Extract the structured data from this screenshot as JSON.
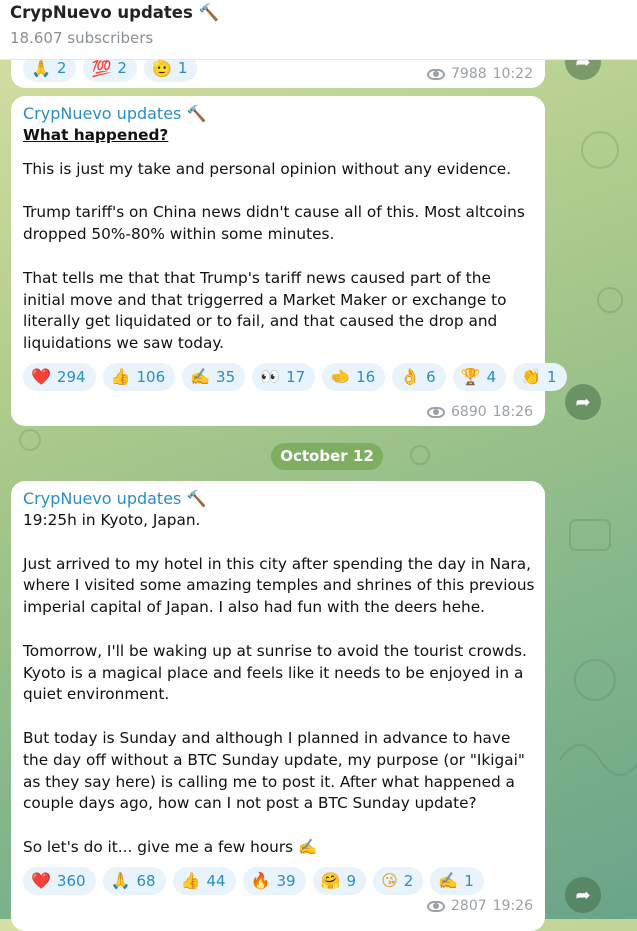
{
  "header": {
    "title": "CrypNuevo updates 🔨",
    "subscribers": "18.607 subscribers"
  },
  "top_post": {
    "reactions": [
      {
        "emoji": "🙏",
        "count": "2"
      },
      {
        "emoji": "💯",
        "count": "2"
      },
      {
        "emoji": "🫡",
        "count": "1"
      }
    ],
    "views": "7988",
    "time": "10:22"
  },
  "post1": {
    "author": "CrypNuevo updates 🔨",
    "heading": "What happened?",
    "body": "This is just my take and personal opinion without any evidence.\n\nTrump tariff's on China news didn't cause all of this. Most altcoins dropped 50%-80% within some minutes.\n\nThat tells me that that Trump's tariff news caused part of the initial move and that triggerred a Market Maker or exchange to literally get liquidated or to fail, and that caused the drop and liquidations we saw today.",
    "reactions": [
      {
        "emoji": "❤️",
        "count": "294"
      },
      {
        "emoji": "👍",
        "count": "106"
      },
      {
        "emoji": "✍️",
        "count": "35"
      },
      {
        "emoji": "👀",
        "count": "17"
      },
      {
        "emoji": "🫲",
        "count": "16"
      },
      {
        "emoji": "👌",
        "count": "6"
      },
      {
        "emoji": "🏆",
        "count": "4"
      },
      {
        "emoji": "👏",
        "count": "1"
      }
    ],
    "views": "6890",
    "time": "18:26"
  },
  "date_separator": "October 12",
  "post2": {
    "author": "CrypNuevo updates 🔨",
    "body": "19:25h in Kyoto, Japan.\n\nJust arrived to my hotel in this city after spending the day in Nara, where I visited some amazing temples and shrines of this previous imperial capital of Japan. I also had fun with the deers hehe.\n\nTomorrow, I'll be waking up at sunrise to avoid the tourist crowds. Kyoto is a magical place and feels like it needs to be enjoyed in a quiet environment.\n\nBut today is Sunday and although I planned in advance to have the day off without a BTC Sunday update, my purpose (or \"Ikigai\" as they say here) is calling me to post it. After what happened a couple days ago, how can I not post a BTC Sunday update?\n\nSo let's do it... give me a few hours ✍️",
    "reactions": [
      {
        "emoji": "❤️",
        "count": "360"
      },
      {
        "emoji": "🙏",
        "count": "68"
      },
      {
        "emoji": "👍",
        "count": "44"
      },
      {
        "emoji": "🔥",
        "count": "39"
      },
      {
        "emoji": "🤗",
        "count": "9"
      },
      {
        "emoji": "😘",
        "count": "2"
      },
      {
        "emoji": "✍️",
        "count": "1"
      }
    ],
    "views": "2807",
    "time": "19:26"
  },
  "icons": {
    "share": "share-icon",
    "views": "eye-icon"
  }
}
